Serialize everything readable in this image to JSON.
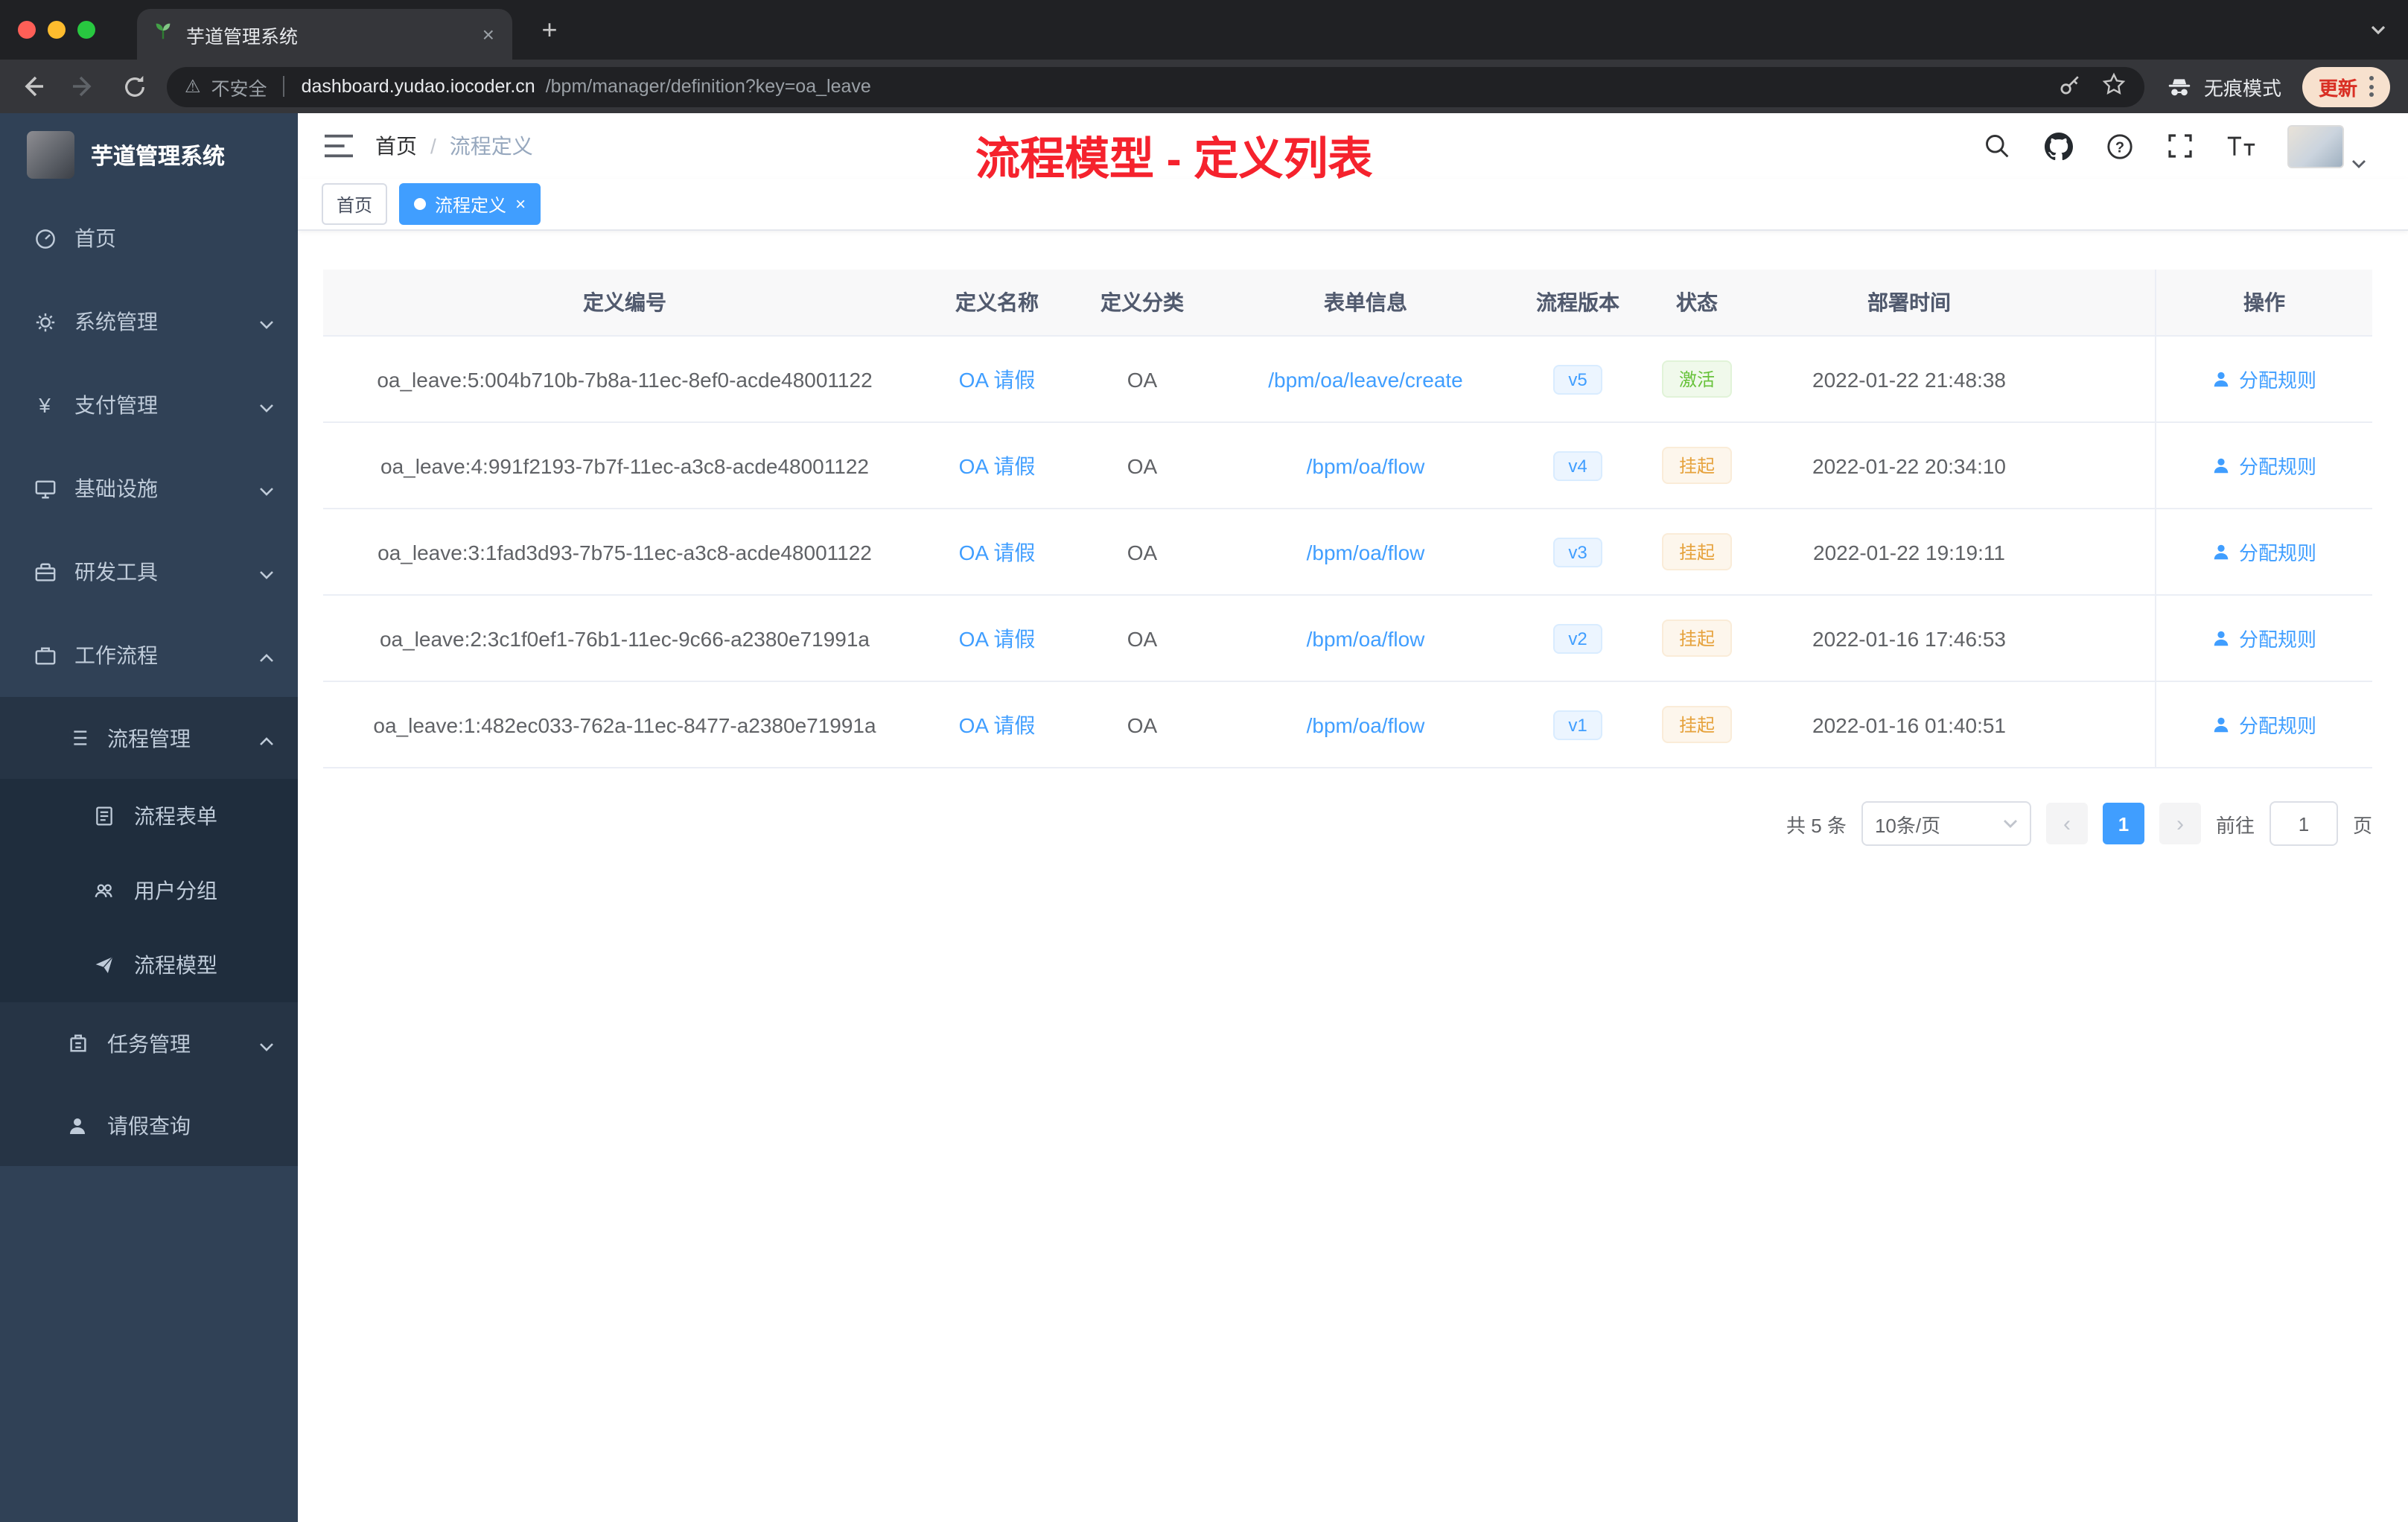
{
  "browser": {
    "tab": {
      "title": "芋道管理系统",
      "close": "×"
    },
    "newtab": "+",
    "url": {
      "security": "不安全",
      "domain": "dashboard.yudao.iocoder.cn",
      "path": "/bpm/manager/definition?key=oa_leave"
    },
    "incognito": "无痕模式",
    "update": "更新"
  },
  "sidebar": {
    "title": "芋道管理系统",
    "items": [
      {
        "label": "首页"
      },
      {
        "label": "系统管理"
      },
      {
        "label": "支付管理"
      },
      {
        "label": "基础设施"
      },
      {
        "label": "研发工具"
      },
      {
        "label": "工作流程"
      }
    ],
    "submenu": {
      "process_mgmt": "流程管理",
      "children": [
        "流程表单",
        "用户分组",
        "流程模型"
      ],
      "task_mgmt": "任务管理",
      "leave_query": "请假查询"
    }
  },
  "header": {
    "breadcrumb": [
      "首页",
      "流程定义"
    ],
    "separator": "/",
    "annotation": "流程模型 - 定义列表"
  },
  "tags": [
    {
      "label": "首页"
    },
    {
      "label": "流程定义",
      "close": "×"
    }
  ],
  "table": {
    "headers": [
      "定义编号",
      "定义名称",
      "定义分类",
      "表单信息",
      "流程版本",
      "状态",
      "部署时间",
      "操作"
    ],
    "rows": [
      {
        "id": "oa_leave:5:004b710b-7b8a-11ec-8ef0-acde48001122",
        "name": "OA 请假",
        "category": "OA",
        "form": "/bpm/oa/leave/create",
        "version": "v5",
        "status": "激活",
        "time": "2022-01-22 21:48:38",
        "action": "分配规则"
      },
      {
        "id": "oa_leave:4:991f2193-7b7f-11ec-a3c8-acde48001122",
        "name": "OA 请假",
        "category": "OA",
        "form": "/bpm/oa/flow",
        "version": "v4",
        "status": "挂起",
        "time": "2022-01-22 20:34:10",
        "action": "分配规则"
      },
      {
        "id": "oa_leave:3:1fad3d93-7b75-11ec-a3c8-acde48001122",
        "name": "OA 请假",
        "category": "OA",
        "form": "/bpm/oa/flow",
        "version": "v3",
        "status": "挂起",
        "time": "2022-01-22 19:19:11",
        "action": "分配规则"
      },
      {
        "id": "oa_leave:2:3c1f0ef1-76b1-11ec-9c66-a2380e71991a",
        "name": "OA 请假",
        "category": "OA",
        "form": "/bpm/oa/flow",
        "version": "v2",
        "status": "挂起",
        "time": "2022-01-16 17:46:53",
        "action": "分配规则"
      },
      {
        "id": "oa_leave:1:482ec033-762a-11ec-8477-a2380e71991a",
        "name": "OA 请假",
        "category": "OA",
        "form": "/bpm/oa/flow",
        "version": "v1",
        "status": "挂起",
        "time": "2022-01-16 01:40:51",
        "action": "分配规则"
      }
    ]
  },
  "pagination": {
    "total": "共 5 条",
    "page_size": "10条/页",
    "prev": "‹",
    "page": "1",
    "next": "›",
    "goto": "前往",
    "goto_value": "1",
    "unit": "页"
  },
  "colors": {
    "accent": "#409eff",
    "status_active": "#67c23a",
    "status_suspended": "#e6a23c",
    "annotation": "#f5222d",
    "sidebar_bg": "#304156"
  }
}
